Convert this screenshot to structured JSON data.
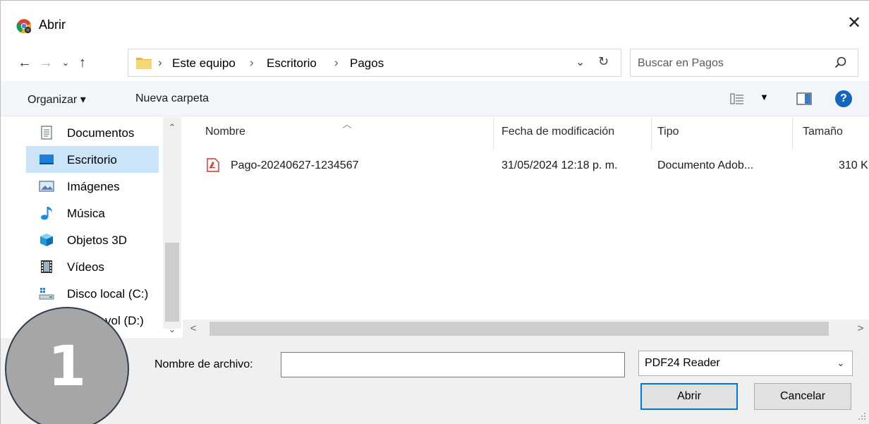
{
  "window": {
    "title": "Abrir",
    "close_glyph": "✕"
  },
  "nav": {
    "back": "←",
    "forward": "→",
    "recent": "⌄",
    "up": "↑"
  },
  "address": {
    "crumbs": [
      "Este equipo",
      "Escritorio",
      "Pagos"
    ],
    "separator": "›",
    "dropdown_glyph": "⌄",
    "refresh_glyph": "↻"
  },
  "search": {
    "placeholder": "Buscar en Pagos"
  },
  "toolbar": {
    "organize_label": "Organizar ▾",
    "new_folder_label": "Nueva carpeta",
    "view_dropdown": "▼",
    "help_label": "?"
  },
  "sidebar": {
    "items": [
      {
        "label": "Documentos",
        "icon": "documents-icon"
      },
      {
        "label": "Escritorio",
        "icon": "desktop-icon",
        "selected": true
      },
      {
        "label": "Imágenes",
        "icon": "pictures-icon"
      },
      {
        "label": "Música",
        "icon": "music-icon"
      },
      {
        "label": "Objetos 3D",
        "icon": "3d-objects-icon"
      },
      {
        "label": "Vídeos",
        "icon": "videos-icon"
      },
      {
        "label": "Disco local (C:)",
        "icon": "local-disk-icon"
      },
      {
        "label": "vol (D:)",
        "icon": "volume-icon"
      }
    ],
    "scroll_up": "⌃",
    "scroll_down": "⌄"
  },
  "file_list": {
    "columns": [
      "Nombre",
      "Fecha de modificación",
      "Tipo",
      "Tamaño"
    ],
    "sort_caret": "︿",
    "rows": [
      {
        "name": "Pago-20240627-1234567",
        "modified": "31/05/2024 12:18 p. m.",
        "type": "Documento Adob...",
        "size": "310 K",
        "icon": "pdf-file-icon"
      }
    ],
    "scroll_left": "<",
    "scroll_right": ">"
  },
  "footer": {
    "filename_label": "Nombre de archivo:",
    "filename_value": "",
    "filename_dropdown": "⌄",
    "filter_value": "PDF24 Reader",
    "filter_dropdown": "⌄",
    "open_button": "Abrir",
    "cancel_button": "Cancelar"
  },
  "step_badge": {
    "number": "1"
  },
  "colors": {
    "accent": "#0078d7",
    "selection": "#cce4f7",
    "toolbar_bg": "#f2f5fa",
    "footer_bg": "#f0f0f0",
    "help_blue": "#1565c0",
    "badge_fill": "#a6a6a6",
    "pdf_red": "#d9302c"
  }
}
